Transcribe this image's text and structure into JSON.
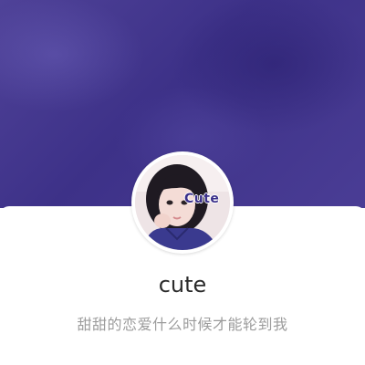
{
  "profile": {
    "avatar_tag": "Cute",
    "name": "cute",
    "bio": "甜甜的恋爱什么时候才能轮到我"
  },
  "colors": {
    "cover": "#43378f",
    "card": "#ffffff",
    "name_text": "#2b2b2b",
    "bio_text": "#9c9c9c"
  }
}
